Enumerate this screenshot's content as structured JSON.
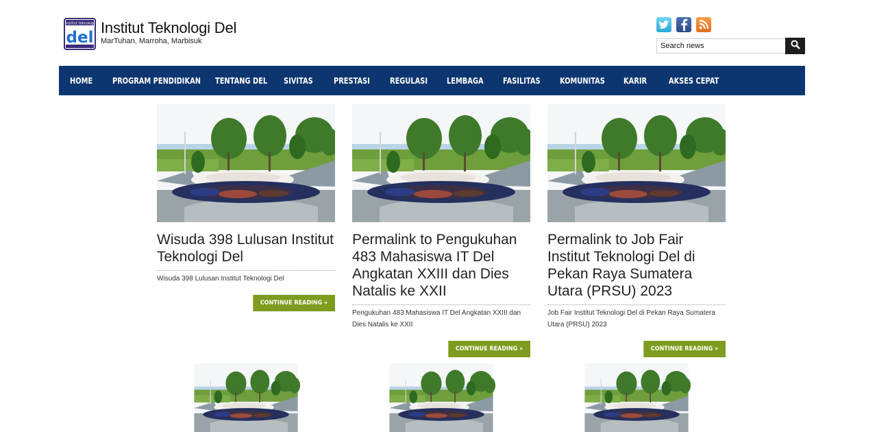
{
  "site": {
    "logo_text": "del",
    "logo_caption": "institut teknologi",
    "title": "Institut Teknologi Del",
    "tagline": "MarTuhan, Marroha, Marbisuk"
  },
  "social": {
    "icons": [
      "twitter-icon",
      "facebook-icon",
      "rss-icon"
    ]
  },
  "search": {
    "placeholder": "Search news",
    "value": ""
  },
  "nav": {
    "items": [
      {
        "label": "HOME"
      },
      {
        "label": "PROGRAM PENDIDIKAN"
      },
      {
        "label": "TENTANG DEL"
      },
      {
        "label": "SIVITAS"
      },
      {
        "label": "PRESTASI"
      },
      {
        "label": "REGULASI"
      },
      {
        "label": "LEMBAGA"
      },
      {
        "label": "FASILITAS"
      },
      {
        "label": "KOMUNITAS"
      },
      {
        "label": "KARIR"
      },
      {
        "label": "AKSES CEPAT"
      }
    ]
  },
  "posts": [
    {
      "title": "Wisuda 398 Lulusan Institut Teknologi Del",
      "excerpt": "Wisuda 398 Lulusan Institut Teknologi Del",
      "more": "CONTINUE READING »"
    },
    {
      "title": "Permalink to Pengukuhan 483 Mahasiswa IT Del Angkatan XXIII dan Dies Natalis ke XXII",
      "excerpt": "Pengukuhan 483 Mahasiswa IT Del Angkatan XXIII dan Dies Natalis ke XXII",
      "more": "CONTINUE READING »"
    },
    {
      "title": "Permalink to Job Fair Institut Teknologi Del di Pekan Raya Sumatera Utara (PRSU) 2023",
      "excerpt": "Job Fair Institut Teknologi Del di Pekan Raya Sumatera Utara (PRSU) 2023",
      "more": "CONTINUE READING »"
    }
  ],
  "colors": {
    "nav_bg": "#0d3670",
    "button_bg": "#7e9c1f"
  }
}
